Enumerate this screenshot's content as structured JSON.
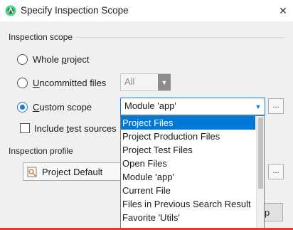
{
  "window": {
    "title": "Specify Inspection Scope",
    "close_glyph": "✕"
  },
  "scope": {
    "label": "Inspection scope",
    "whole_project": {
      "before": "Whole ",
      "mnemonic": "p",
      "after": "roject"
    },
    "uncommitted": {
      "before": "",
      "mnemonic": "U",
      "after": "ncommitted files"
    },
    "uncommitted_combo": "All",
    "custom": {
      "before": "",
      "mnemonic": "C",
      "after": "ustom scope"
    },
    "custom_combo": "Module 'app'",
    "include_tests": {
      "before": "Include ",
      "mnemonic": "t",
      "after": "est sources"
    },
    "selected_option": "custom"
  },
  "dropdown": {
    "items": [
      "Project Files",
      "Project Production Files",
      "Project Test Files",
      "Open Files",
      "Module 'app'",
      "Current File",
      "Files in Previous Search Result",
      "Favorite 'Utils'"
    ],
    "selected_index": 0
  },
  "profile": {
    "label": "Inspection profile",
    "value": "Project Default"
  },
  "buttons": {
    "ellipsis": "...",
    "bottom_partial": "p"
  },
  "colors": {
    "accent": "#1a7bd9",
    "selection": "#0078d7",
    "bottom_bar": "#e53935"
  },
  "icons": {
    "app": "android-studio-icon",
    "profile": "inspection-profile-icon"
  }
}
